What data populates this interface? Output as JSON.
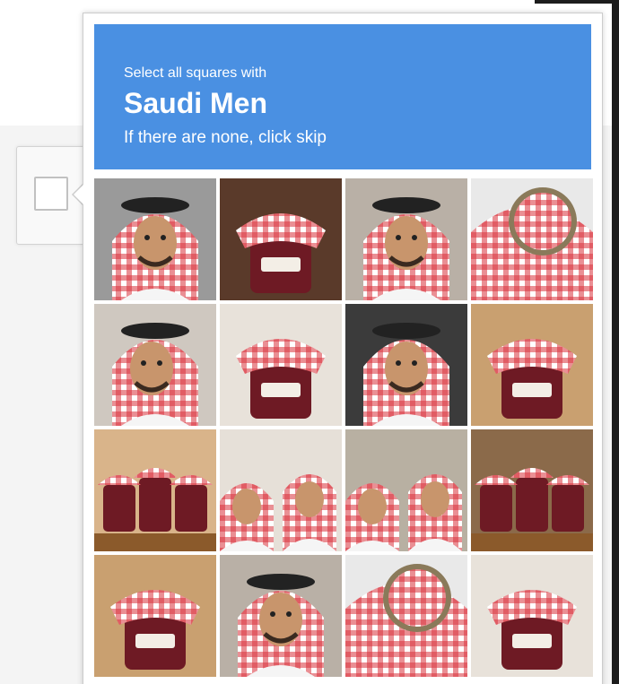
{
  "captcha": {
    "instruction_prefix": "Select all squares with",
    "target_label": "Saudi Men",
    "skip_hint": "If there are none, click skip"
  },
  "colors": {
    "header_blue": "#4a90e2",
    "gingham_red": "#d8323c",
    "jam_dark": "#6e1a24"
  },
  "tiles": [
    {
      "row": 1,
      "col": 1,
      "subject": "man-in-red-white-shemagh-smiling"
    },
    {
      "row": 1,
      "col": 2,
      "subject": "jam-jar-gingham-lid"
    },
    {
      "row": 1,
      "col": 3,
      "subject": "man-in-red-white-shemagh"
    },
    {
      "row": 1,
      "col": 4,
      "subject": "jam-jar-lid-top-view"
    },
    {
      "row": 2,
      "col": 1,
      "subject": "man-in-red-white-shemagh-thinking"
    },
    {
      "row": 2,
      "col": 2,
      "subject": "jam-jars-labeled"
    },
    {
      "row": 2,
      "col": 3,
      "subject": "man-in-shemagh-closeup"
    },
    {
      "row": 2,
      "col": 4,
      "subject": "jam-jar-with-label"
    },
    {
      "row": 3,
      "col": 1,
      "subject": "jam-jars-on-table"
    },
    {
      "row": 3,
      "col": 2,
      "subject": "group-of-saudi-men"
    },
    {
      "row": 3,
      "col": 3,
      "subject": "two-saudi-men"
    },
    {
      "row": 3,
      "col": 4,
      "subject": "jam-jars-on-wood"
    },
    {
      "row": 4,
      "col": 1,
      "subject": "jam-jar-with-label"
    },
    {
      "row": 4,
      "col": 2,
      "subject": "man-in-red-white-shemagh"
    },
    {
      "row": 4,
      "col": 3,
      "subject": "jam-jar-lid-top-view"
    },
    {
      "row": 4,
      "col": 4,
      "subject": "jam-jars-labeled"
    }
  ]
}
